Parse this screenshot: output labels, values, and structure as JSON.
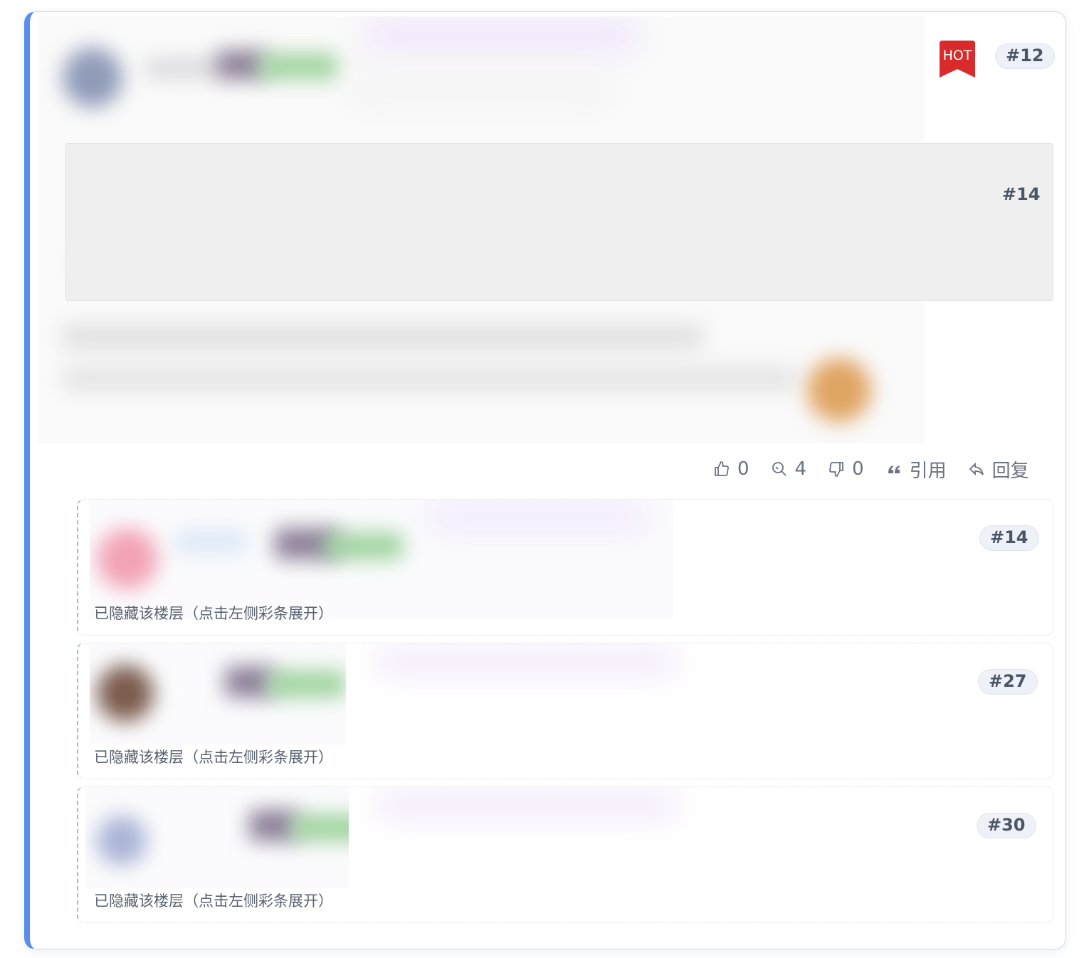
{
  "main_post": {
    "hot_label": "HOT",
    "floor": "#12",
    "quote_floor": "#14",
    "actions": [
      {
        "icon": "thumbs-up-icon",
        "value": "0"
      },
      {
        "icon": "magnify-icon",
        "value": "4"
      },
      {
        "icon": "thumbs-down-icon",
        "value": "0"
      },
      {
        "icon": "quote-icon",
        "value": "引用"
      },
      {
        "icon": "reply-icon",
        "value": "回复"
      }
    ]
  },
  "replies": [
    {
      "floor": "#14",
      "note": "已隐藏该楼层（点击左侧彩条展开）"
    },
    {
      "floor": "#27",
      "note": "已隐藏该楼层（点击左侧彩条展开）"
    },
    {
      "floor": "#30",
      "note": "已隐藏该楼层（点击左侧彩条展开）"
    }
  ],
  "colors": {
    "accent_bar": "#5b8def",
    "hot_red": "#d92b2b",
    "pill_bg": "#eef2f8"
  }
}
